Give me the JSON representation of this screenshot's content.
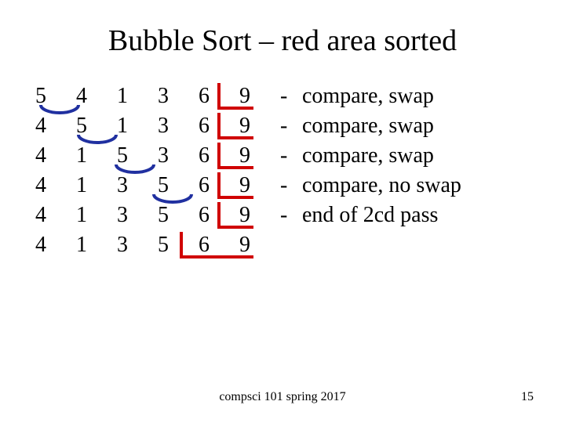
{
  "title": "Bubble Sort – red area sorted",
  "rows": [
    {
      "cells": [
        "5",
        "4",
        "1",
        "3",
        "6",
        "9"
      ],
      "dash": "-",
      "desc": "compare, swap"
    },
    {
      "cells": [
        "4",
        "5",
        "1",
        "3",
        "6",
        "9"
      ],
      "dash": "-",
      "desc": "compare, swap"
    },
    {
      "cells": [
        "4",
        "1",
        "5",
        "3",
        "6",
        "9"
      ],
      "dash": "-",
      "desc": "compare, swap"
    },
    {
      "cells": [
        "4",
        "1",
        "3",
        "5",
        "6",
        "9"
      ],
      "dash": "-",
      "desc": "compare, no swap"
    },
    {
      "cells": [
        "4",
        "1",
        "3",
        "5",
        "6",
        "9"
      ],
      "dash": "-",
      "desc": "end of 2cd pass"
    },
    {
      "cells": [
        "4",
        "1",
        "3",
        "5",
        "6",
        "9"
      ],
      "dash": "",
      "desc": ""
    }
  ],
  "footer": "compsci 101 spring 2017",
  "page": "15",
  "colors": {
    "red": "#d00000",
    "blue": "#2030a0"
  }
}
